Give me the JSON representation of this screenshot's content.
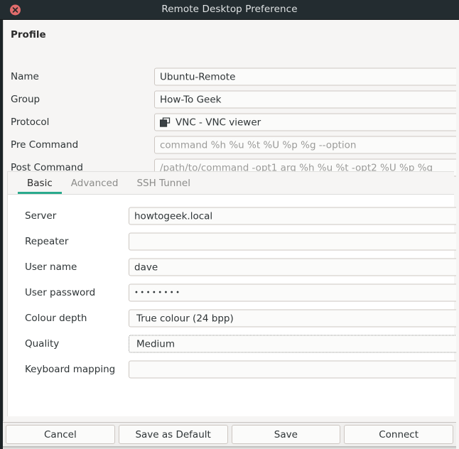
{
  "window": {
    "title": "Remote Desktop Preference",
    "close_icon": "close-icon"
  },
  "profile": {
    "section_label": "Profile",
    "rows": [
      {
        "label": "Name",
        "value": "Ubuntu-Remote",
        "placeholder": "",
        "is_placeholder": false,
        "icon": ""
      },
      {
        "label": "Group",
        "value": "How-To Geek",
        "placeholder": "",
        "is_placeholder": false,
        "icon": ""
      },
      {
        "label": "Protocol",
        "value": "VNC - VNC viewer",
        "placeholder": "",
        "is_placeholder": false,
        "icon": "windows-stack-icon"
      },
      {
        "label": "Pre Command",
        "value": "",
        "placeholder": "command %h %u %t %U %p %g --option",
        "is_placeholder": true,
        "icon": ""
      },
      {
        "label": "Post Command",
        "value": "",
        "placeholder": "/path/to/command -opt1 arg %h %u %t -opt2 %U %p %g",
        "is_placeholder": true,
        "icon": ""
      }
    ]
  },
  "tabs": [
    {
      "label": "Basic",
      "active": true
    },
    {
      "label": "Advanced",
      "active": false
    },
    {
      "label": "SSH Tunnel",
      "active": false
    }
  ],
  "basic": {
    "rows": [
      {
        "label": "Server",
        "value": "howtogeek.local",
        "type": "text",
        "focused": false
      },
      {
        "label": "Repeater",
        "value": "",
        "type": "text",
        "focused": false
      },
      {
        "label": "User name",
        "value": "dave",
        "type": "text",
        "focused": false
      },
      {
        "label": "User password",
        "value": "••••••••",
        "type": "password",
        "focused": false
      },
      {
        "label": "Colour depth",
        "value": "True colour (24 bpp)",
        "type": "select",
        "focused": false
      },
      {
        "label": "Quality",
        "value": "Medium",
        "type": "select",
        "focused": true
      },
      {
        "label": "Keyboard mapping",
        "value": "",
        "type": "text",
        "focused": false
      }
    ]
  },
  "buttons": [
    {
      "label": "Cancel"
    },
    {
      "label": "Save as Default"
    },
    {
      "label": "Save"
    },
    {
      "label": "Connect"
    }
  ],
  "colors": {
    "titlebar_bg": "#232c30",
    "close_button": "#e26c6c",
    "accent_tab_underline": "#2aaa8d",
    "panel_bg": "#f6f5f4",
    "field_bg": "#fbfbfa",
    "field_border": "#cdc7c2",
    "text": "#2e3436",
    "placeholder_text": "#9b9b99",
    "backdrop_strip": "#cd2323"
  }
}
